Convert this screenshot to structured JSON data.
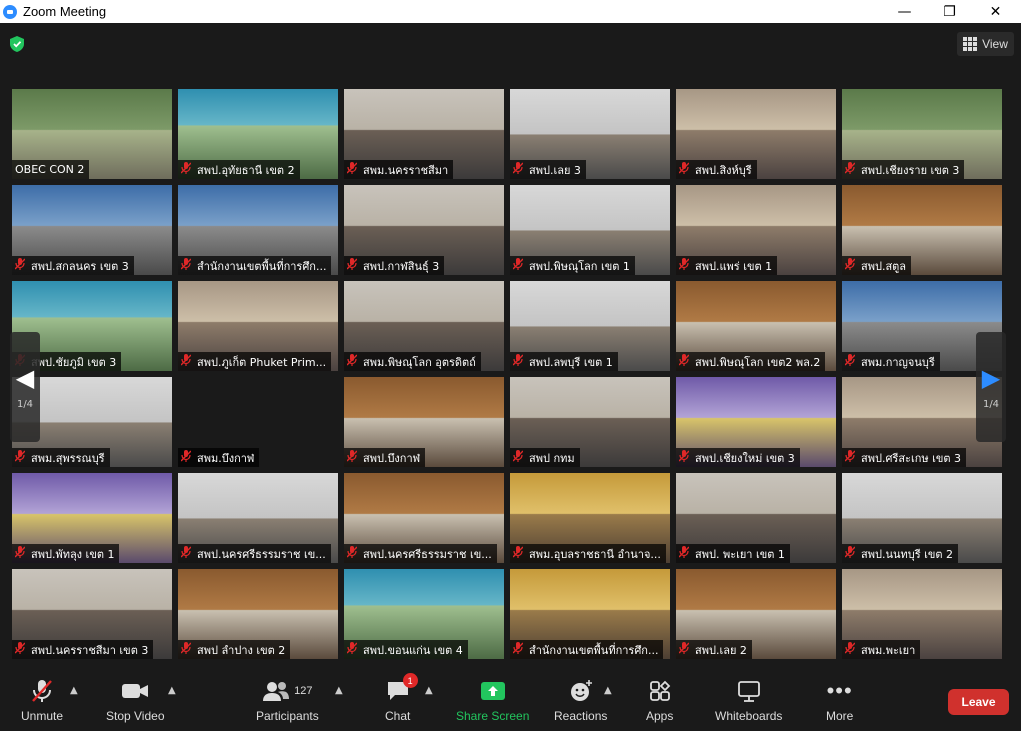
{
  "window": {
    "title": "Zoom Meeting",
    "minimize": "—",
    "maximize": "❐",
    "close": "✕"
  },
  "view_button": {
    "label": "View"
  },
  "pager": {
    "left_page": "1/4",
    "right_page": "1/4"
  },
  "colors": {
    "active_border": "#e5e77c",
    "leave": "#d0312d",
    "share": "#22c55e",
    "mic_off": "#e02828"
  },
  "tiles": [
    {
      "name": "OBEC CON 2",
      "muted": false,
      "active": true,
      "scene": "green"
    },
    {
      "name": "สพป.อุทัยธานี เขต 2",
      "muted": true,
      "scene": "teal"
    },
    {
      "name": "สพม.นครราชสีมา",
      "muted": true,
      "scene": "office"
    },
    {
      "name": "สพป.เลย 3",
      "muted": true,
      "scene": "hall"
    },
    {
      "name": "สพป.สิงห์บุรี",
      "muted": true,
      "scene": "warm"
    },
    {
      "name": "สพป.เชียงราย เขต 3",
      "muted": true,
      "scene": "green"
    },
    {
      "name": "สพป.สกลนคร เขต 3",
      "muted": true,
      "scene": "blue"
    },
    {
      "name": "สำนักงานเขตพื้นที่การศึก...",
      "muted": true,
      "scene": "blue"
    },
    {
      "name": "สพป.กาฬสินธุ์ 3",
      "muted": true,
      "scene": "office"
    },
    {
      "name": "สพป.พิษณุโลก เขต 1",
      "muted": true,
      "scene": "hall"
    },
    {
      "name": "สพป.แพร่ เขต 1",
      "muted": true,
      "scene": "warm"
    },
    {
      "name": "สพป.สตูล",
      "muted": true,
      "scene": "wood"
    },
    {
      "name": "สพป.ชัยภูมิ เขต 3",
      "muted": true,
      "scene": "teal"
    },
    {
      "name": "สพป.ภูเก็ต Phuket Prim...",
      "muted": true,
      "scene": "warm"
    },
    {
      "name": "สพม.พิษณุโลก อุตรดิตถ์",
      "muted": true,
      "scene": "office"
    },
    {
      "name": "สพป.ลพบุรี เขต 1",
      "muted": true,
      "scene": "hall"
    },
    {
      "name": "สพป.พิษณุโลก เขต2 พล.2",
      "muted": true,
      "scene": "wood"
    },
    {
      "name": "สพม.กาญจนบุรี",
      "muted": true,
      "scene": "blue"
    },
    {
      "name": "สพม.สุพรรณบุรี",
      "muted": true,
      "scene": "hall"
    },
    {
      "name": "สพม.บึงกาฬ",
      "muted": true,
      "blank": true,
      "scene": "none"
    },
    {
      "name": "สพป.บึงกาฬ",
      "muted": true,
      "scene": "wood"
    },
    {
      "name": "สพป กทม",
      "muted": true,
      "scene": "office"
    },
    {
      "name": "สพป.เชียงใหม่ เขต 3",
      "muted": true,
      "scene": "purple"
    },
    {
      "name": "สพป.ศรีสะเกษ เขต 3",
      "muted": true,
      "scene": "warm"
    },
    {
      "name": "สพป.พัทลุง เขต 1",
      "muted": true,
      "scene": "purple"
    },
    {
      "name": "สพป.นครศรีธรรมราช เข...",
      "muted": true,
      "scene": "hall"
    },
    {
      "name": "สพป.นครศรีธรรมราช เข...",
      "muted": true,
      "scene": "wood"
    },
    {
      "name": "สพม.อุบลราชธานี อำนาจ...",
      "muted": true,
      "scene": "gold"
    },
    {
      "name": "สพป. พะเยา เขต 1",
      "muted": true,
      "scene": "office"
    },
    {
      "name": "สพป.นนทบุรี เขต 2",
      "muted": true,
      "scene": "hall"
    },
    {
      "name": "สพป.นครราชสีมา เขต 3",
      "muted": true,
      "scene": "office"
    },
    {
      "name": "สพป ลำปาง เขต 2",
      "muted": true,
      "scene": "wood"
    },
    {
      "name": "สพป.ขอนแก่น เขต 4",
      "muted": true,
      "scene": "teal"
    },
    {
      "name": "สำนักงานเขตพื้นที่การศึก...",
      "muted": true,
      "scene": "gold"
    },
    {
      "name": "สพป.เลย 2",
      "muted": true,
      "scene": "wood"
    },
    {
      "name": "สพม.พะเยา",
      "muted": true,
      "scene": "warm"
    }
  ],
  "toolbar": {
    "unmute": "Unmute",
    "stop_video": "Stop Video",
    "participants": "Participants",
    "participants_count": "127",
    "chat": "Chat",
    "chat_badge": "1",
    "share_screen": "Share Screen",
    "reactions": "Reactions",
    "apps": "Apps",
    "whiteboards": "Whiteboards",
    "more": "More",
    "leave": "Leave"
  }
}
